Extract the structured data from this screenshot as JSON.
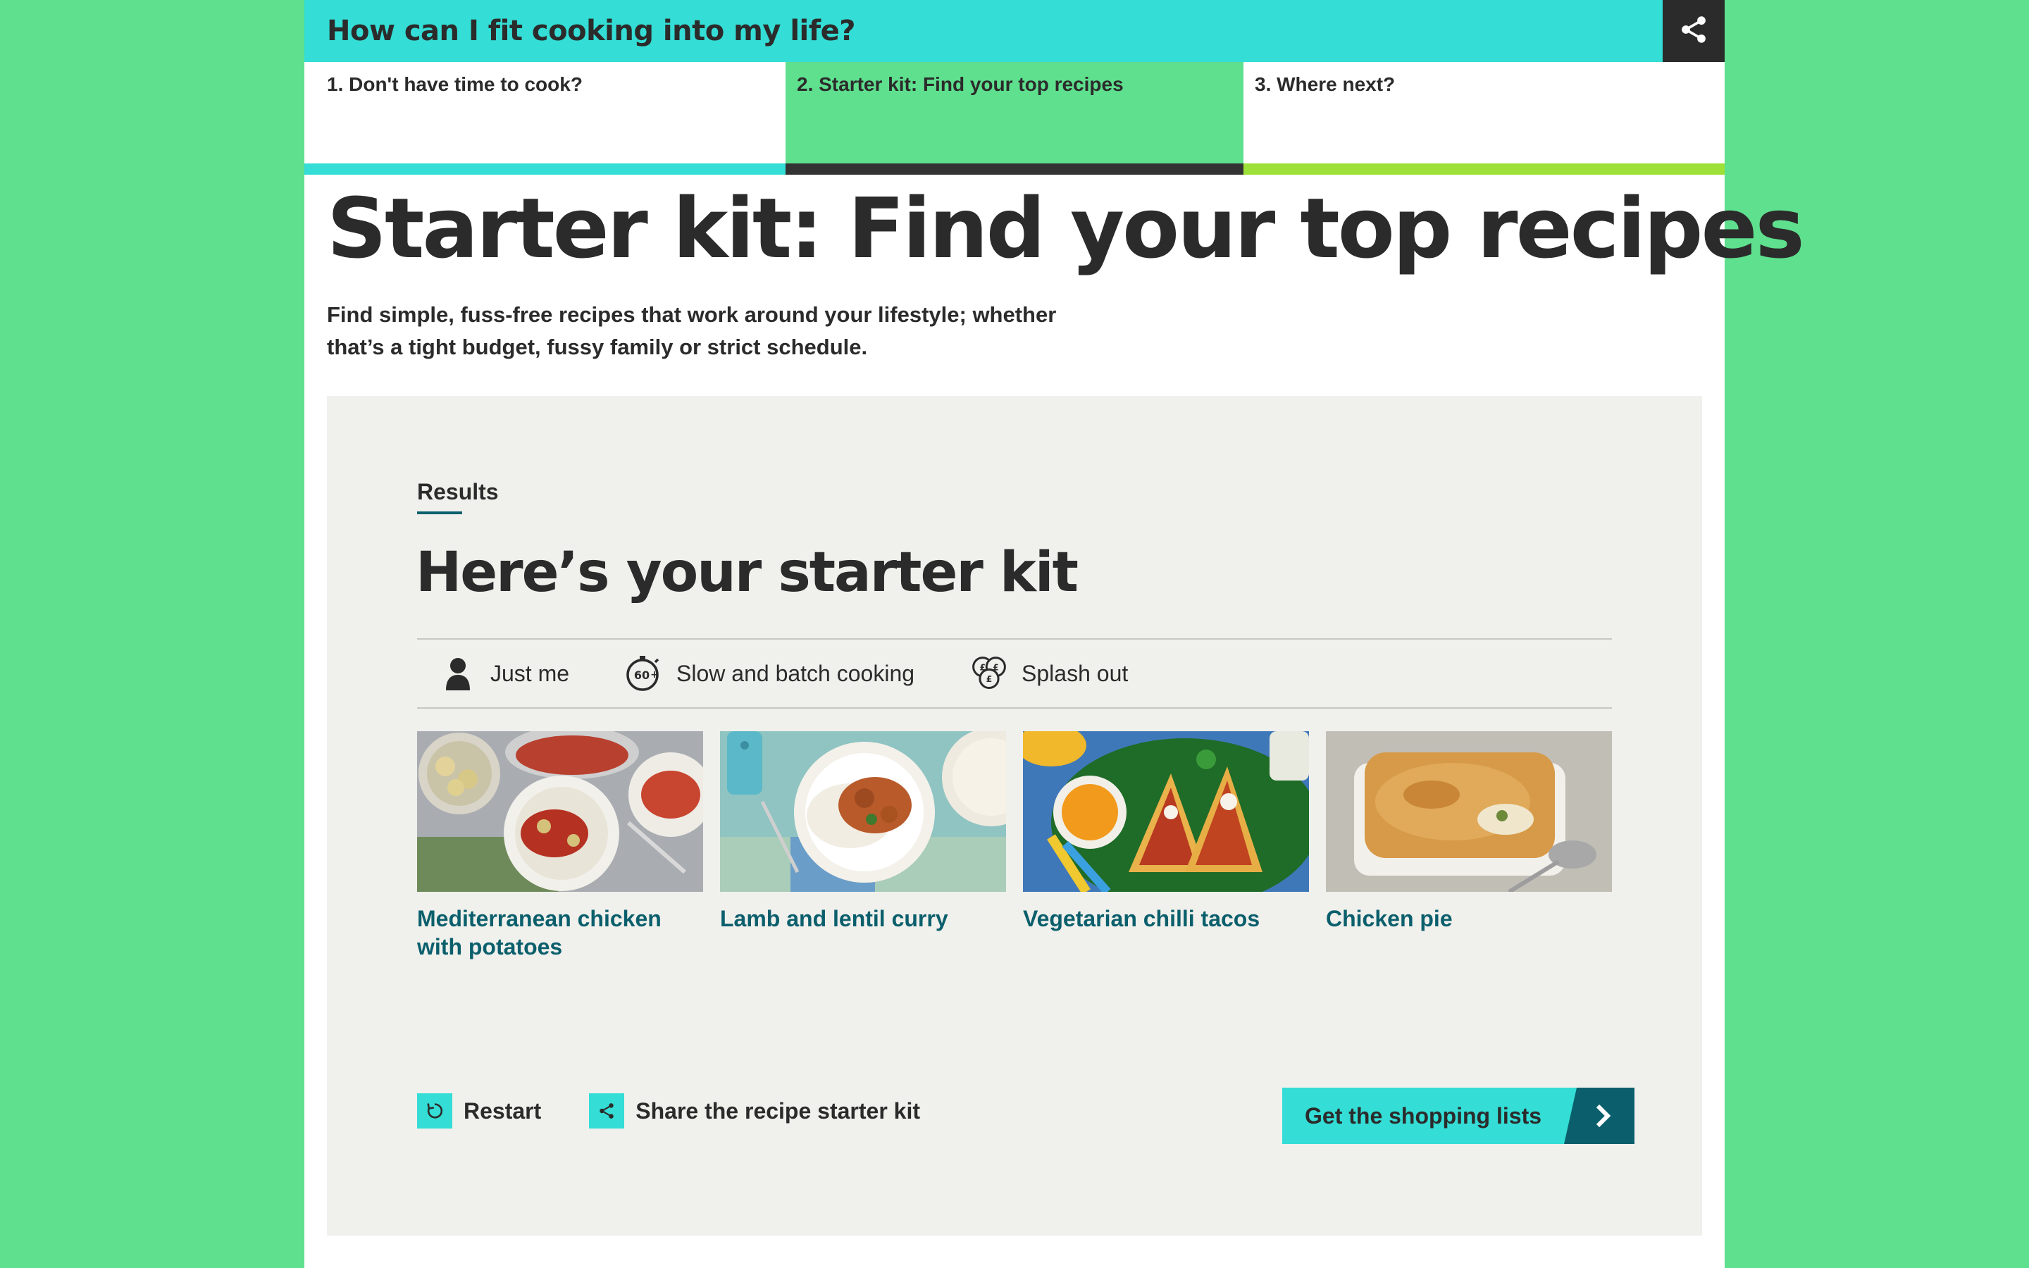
{
  "header": {
    "title": "How can I fit cooking into my life?",
    "share_icon": "share-icon"
  },
  "tabs": [
    {
      "label": "1. Don't have time to cook?",
      "bar_color": "#34ddd5"
    },
    {
      "label": "2. Starter kit: Find your top recipes",
      "bar_color": "#333333",
      "active": true
    },
    {
      "label": "3. Where next?",
      "bar_color": "#9de038"
    }
  ],
  "main": {
    "title": "Starter kit: Find your top recipes",
    "intro": "Find simple, fuss-free recipes that work around your lifestyle; whether that’s a tight budget, fussy family or strict schedule."
  },
  "results": {
    "label": "Results",
    "title": "Here’s your starter kit",
    "filters": [
      {
        "icon": "person-icon",
        "label": "Just me"
      },
      {
        "icon": "timer-60-icon",
        "label": "Slow and batch cooking",
        "icon_text": "60"
      },
      {
        "icon": "coins-icon",
        "label": "Splash out"
      }
    ],
    "recipes": [
      {
        "name": "Mediterranean chicken with potatoes"
      },
      {
        "name": "Lamb and lentil curry"
      },
      {
        "name": "Vegetarian chilli tacos"
      },
      {
        "name": "Chicken pie"
      }
    ],
    "actions": {
      "restart": "Restart",
      "share": "Share the recipe starter kit"
    },
    "cta": "Get the shopping lists"
  },
  "colors": {
    "background": "#5fe08e",
    "accent": "#34ddd5",
    "link": "#0b5f6c",
    "panel": "#f0f0ec"
  }
}
